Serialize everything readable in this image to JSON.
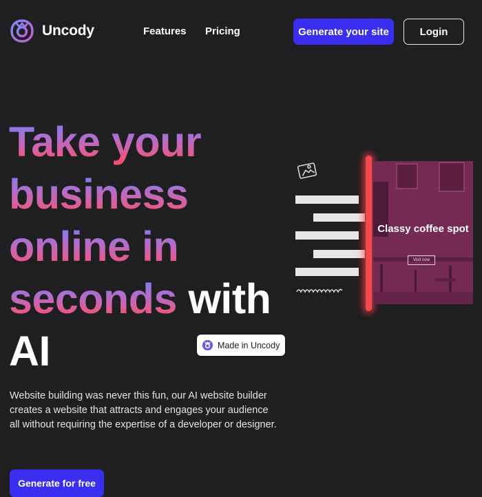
{
  "header": {
    "brand": "Uncody",
    "nav": [
      "Features",
      "Pricing"
    ],
    "generate_label": "Generate your site",
    "login_label": "Login"
  },
  "hero": {
    "line1": "Take your",
    "line2": "business",
    "line3": "online in",
    "line4_grad": "seconds",
    "line4_white": "with",
    "line5": "AI",
    "description": "Website building was never this fun, our AI website builder creates a website that attracts and engages your audience all without requiring the expertise of a developer or designer.",
    "cta_label": "Generate for free"
  },
  "badge": {
    "label": "Made in Uncody"
  },
  "illustration": {
    "card_title": "Classy coffee spot",
    "card_button": "Visit now"
  },
  "colors": {
    "background": "#1f1e20",
    "accent": "#3a2ff0",
    "gradient_top": "#6a8cf5",
    "gradient_bottom": "#f54f6e",
    "laser": "#f0494e"
  },
  "icons": [
    "uncody-logo-icon",
    "image-icon",
    "squiggle-icon"
  ]
}
